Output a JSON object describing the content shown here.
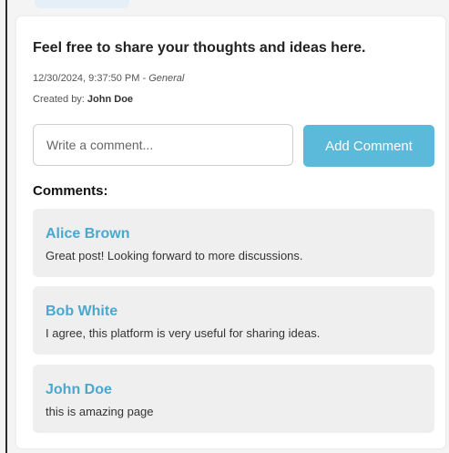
{
  "post": {
    "title": "Feel free to share your thoughts and ideas here.",
    "timestamp": "12/30/2024, 9:37:50 PM",
    "separator": " - ",
    "category": "General",
    "created_by_label": "Created by: ",
    "author": "John Doe"
  },
  "comment_form": {
    "placeholder": "Write a comment...",
    "value": "",
    "submit_label": "Add Comment"
  },
  "comments": {
    "heading": "Comments:",
    "items": [
      {
        "author": "Alice Brown",
        "text": "Great post! Looking forward to more discussions."
      },
      {
        "author": "Bob White",
        "text": "I agree, this platform is very useful for sharing ideas."
      },
      {
        "author": "John Doe",
        "text": "this is amazing page"
      }
    ]
  },
  "colors": {
    "accent": "#5bb9d9",
    "author_link": "#4aa8cf",
    "comment_bg": "#efefef",
    "page_bg": "#f4f4f4"
  }
}
